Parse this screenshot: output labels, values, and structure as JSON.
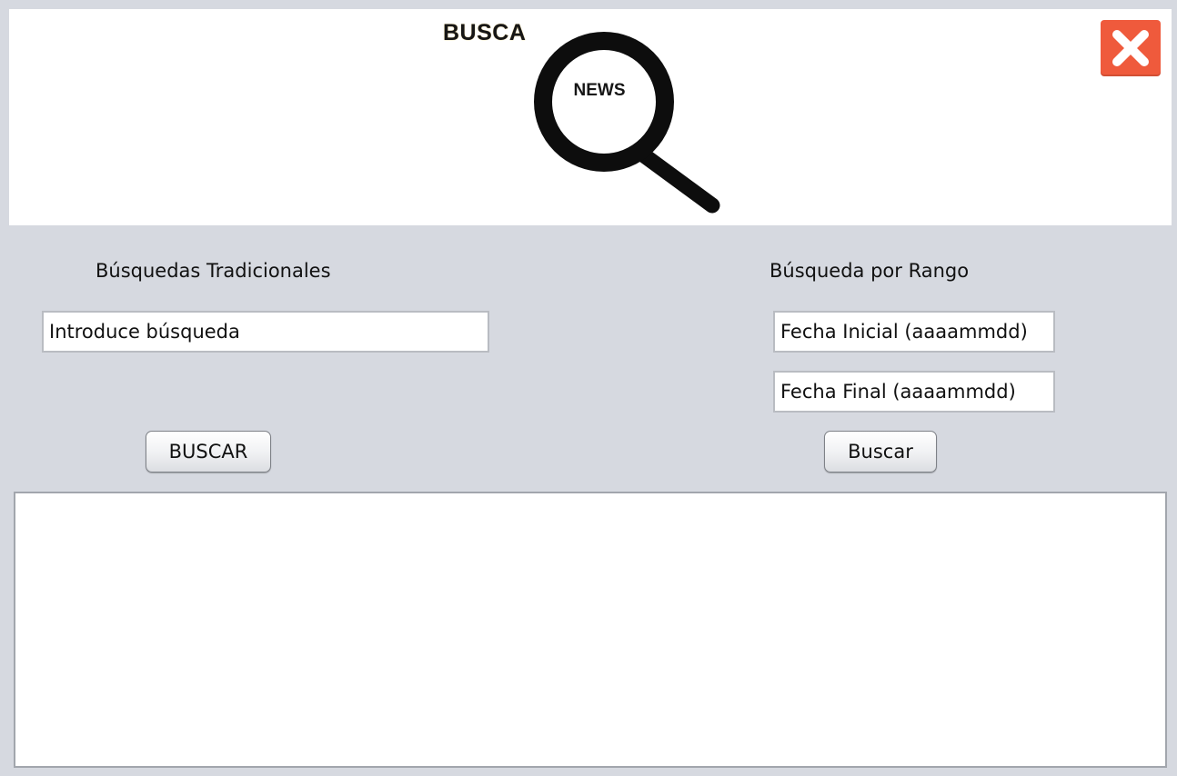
{
  "header": {
    "logo_text": "BUSCA",
    "logo_badge": "NEWS"
  },
  "icons": {
    "logo": "magnifier-icon",
    "close": "close-icon"
  },
  "colors": {
    "background": "#d6d9e0",
    "close_button": "#ef5a3c"
  },
  "traditional": {
    "title": "Búsquedas Tradicionales",
    "query_value": "Introduce búsqueda",
    "button_label": "BUSCAR"
  },
  "range": {
    "title": "Búsqueda por Rango",
    "start_value": "Fecha Inicial (aaaammdd)",
    "end_value": "Fecha Final (aaaammdd)",
    "button_label": "Buscar"
  },
  "results": {
    "value": ""
  }
}
